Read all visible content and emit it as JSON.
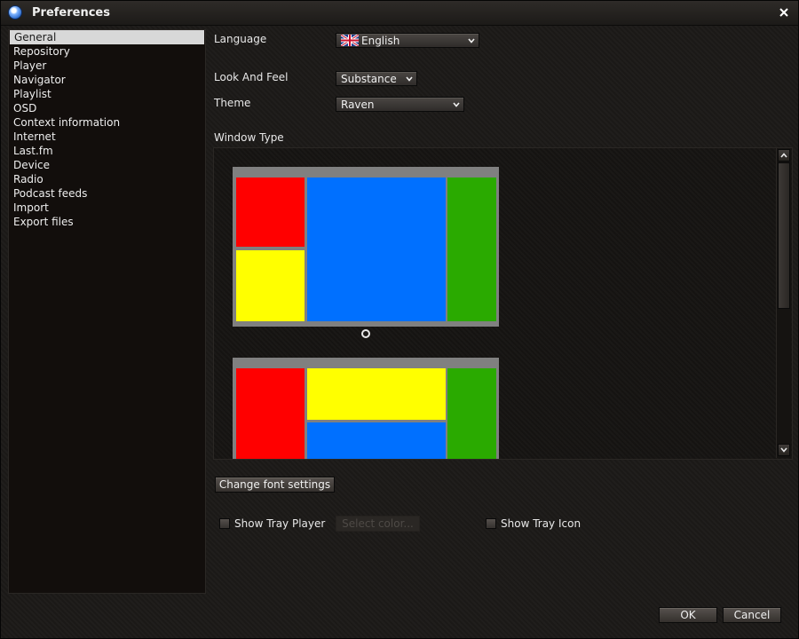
{
  "window": {
    "title": "Preferences",
    "icon": "app-icon"
  },
  "sidebar": {
    "items": [
      {
        "label": "General",
        "selected": true
      },
      {
        "label": "Repository"
      },
      {
        "label": "Player"
      },
      {
        "label": "Navigator"
      },
      {
        "label": "Playlist"
      },
      {
        "label": "OSD"
      },
      {
        "label": "Context information"
      },
      {
        "label": "Internet"
      },
      {
        "label": "Last.fm"
      },
      {
        "label": "Device"
      },
      {
        "label": "Radio"
      },
      {
        "label": "Podcast feeds"
      },
      {
        "label": "Import"
      },
      {
        "label": "Export files"
      }
    ]
  },
  "general": {
    "language_label": "Language",
    "language_value": "English",
    "look_and_feel_label": "Look And Feel",
    "look_and_feel_value": "Substance",
    "theme_label": "Theme",
    "theme_value": "Raven",
    "window_type_label": "Window Type",
    "change_font_button": "Change font settings",
    "show_tray_player_label": "Show Tray Player",
    "select_color_button": "Select color...",
    "show_tray_icon_label": "Show Tray Icon"
  },
  "footer": {
    "ok_label": "OK",
    "cancel_label": "Cancel"
  },
  "colors": {
    "red": "#ff0000",
    "blue": "#0070ff",
    "green": "#2aaa00",
    "yellow": "#ffff00",
    "frame": "#808080"
  }
}
